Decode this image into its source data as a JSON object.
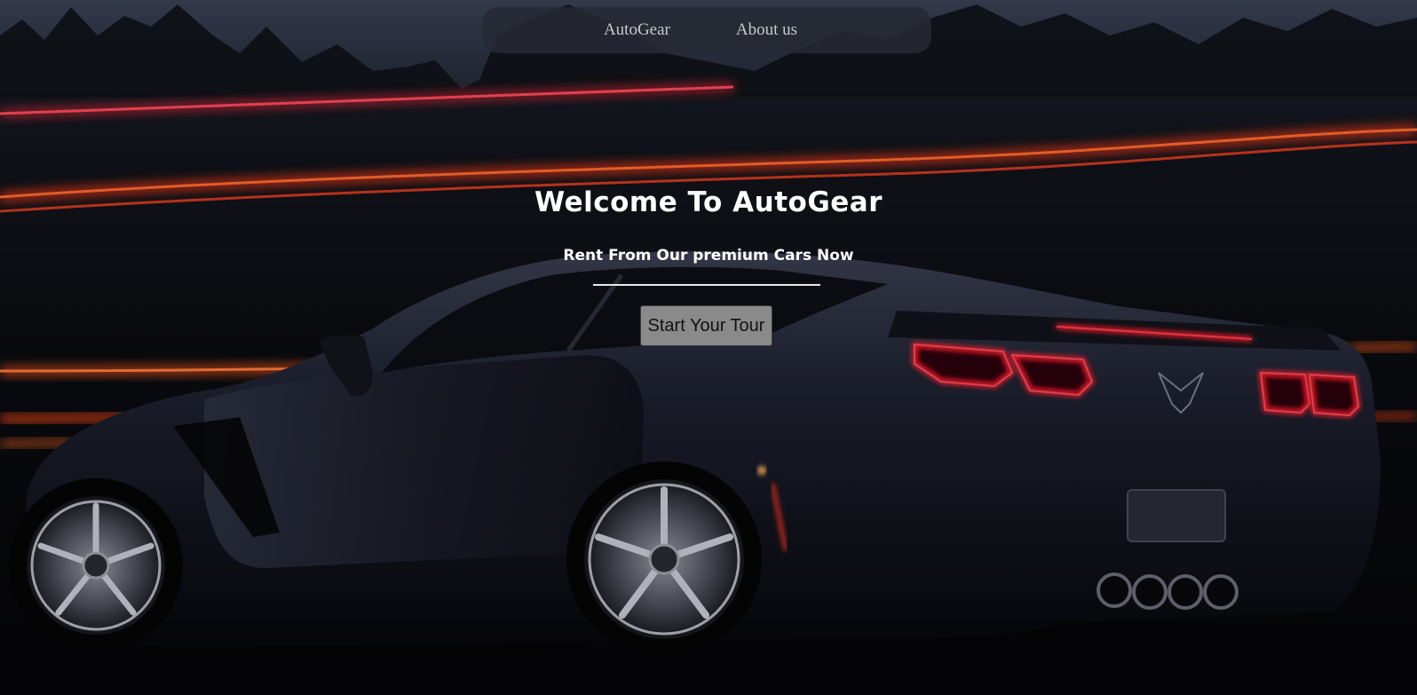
{
  "nav": {
    "links": [
      "AutoGear",
      "About us"
    ]
  },
  "hero": {
    "title": "Welcome To AutoGear",
    "subtitle": "Rent From Our premium Cars Now",
    "cta_label": "Start Your Tour",
    "background_image": "night-sports-car-light-trails",
    "colors": {
      "title_text": "#ffffff",
      "button_bg": "#8a8a8a",
      "navbar_bg": "#262a34",
      "light_trail": "#ff3a20"
    }
  }
}
